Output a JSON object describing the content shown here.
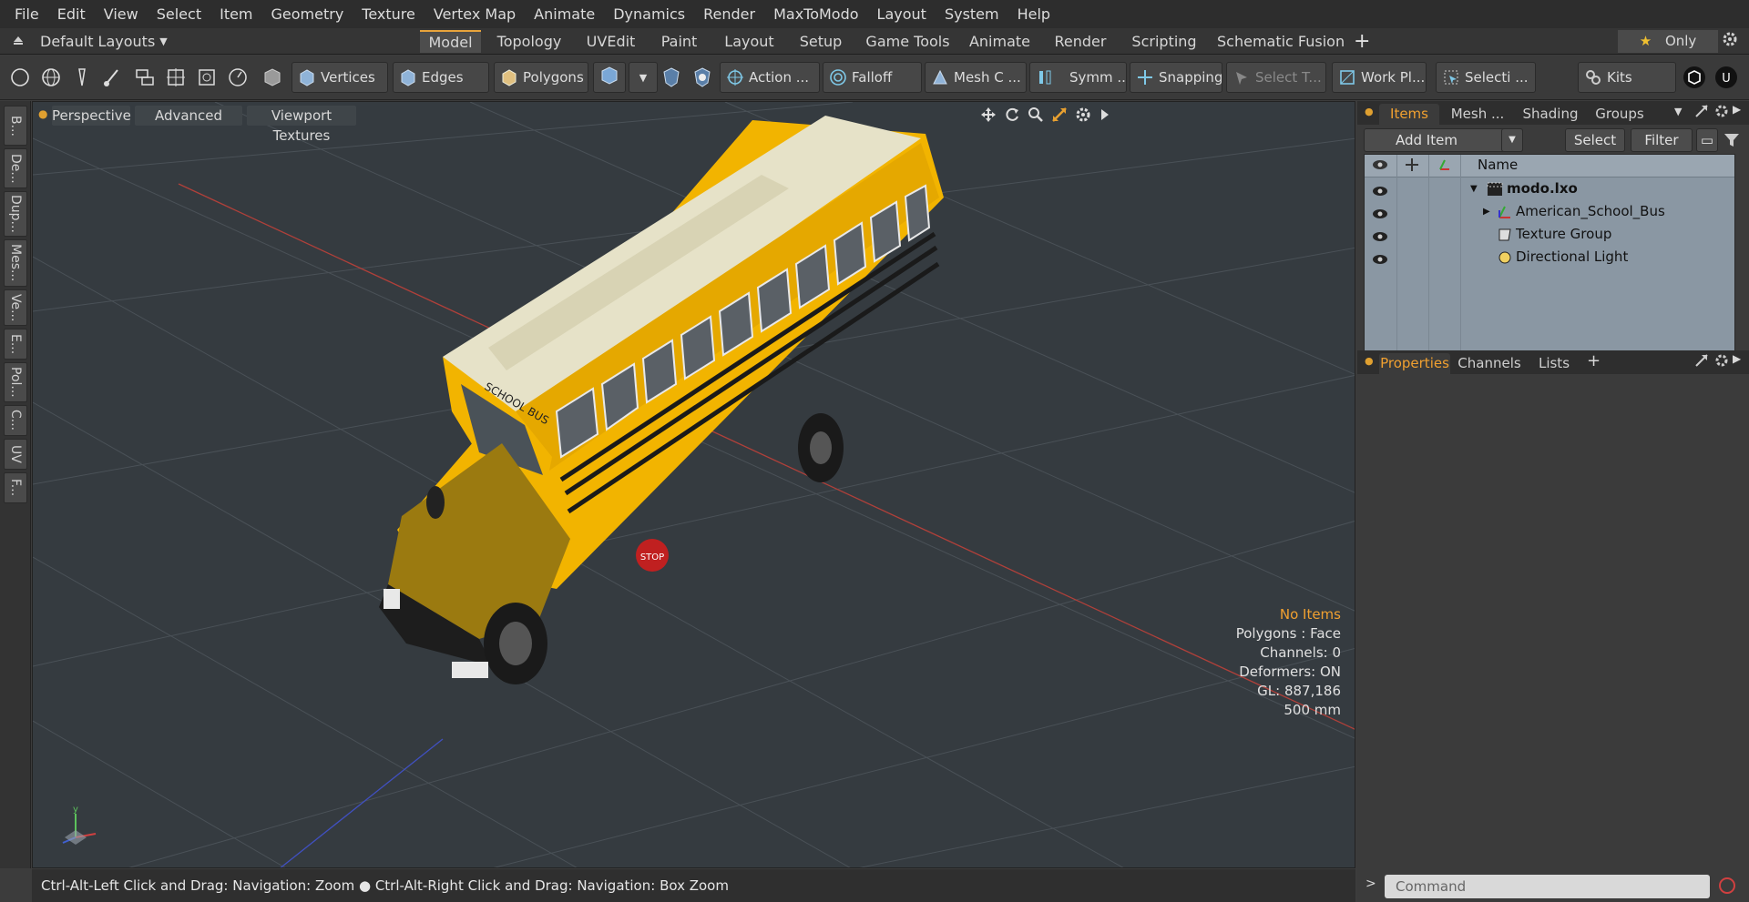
{
  "menu": [
    "File",
    "Edit",
    "View",
    "Select",
    "Item",
    "Geometry",
    "Texture",
    "Vertex Map",
    "Animate",
    "Dynamics",
    "Render",
    "MaxToModo",
    "Layout",
    "System",
    "Help"
  ],
  "layout_selector": "Default Layouts",
  "tabs": [
    "Model",
    "Topology",
    "UVEdit",
    "Paint",
    "Layout",
    "Setup",
    "Game Tools",
    "Animate",
    "Render",
    "Scripting",
    "Schematic Fusion"
  ],
  "active_tab": "Model",
  "only_button": "Only",
  "toolbar": {
    "vertices": "Vertices",
    "edges": "Edges",
    "polygons": "Polygons",
    "action": "Action ...",
    "falloff": "Falloff",
    "mesh": "Mesh C ...",
    "symmetry": "Symm ...",
    "snapping": "Snapping",
    "select_t": "Select T...",
    "workplane": "Work Pl...",
    "selection": "Selecti ...",
    "kits": "Kits"
  },
  "left_tools": [
    "B...",
    "De...",
    "Dup...",
    "Mes...",
    "Ve...",
    "E...",
    "Pol...",
    "C...",
    "UV",
    "F..."
  ],
  "viewport": {
    "tabs": [
      "Perspective",
      "Advanced",
      "Viewport Textures"
    ],
    "stats": [
      "No Items",
      "Polygons : Face",
      "Channels: 0",
      "Deformers: ON",
      "GL: 887,186",
      "500 mm"
    ],
    "bus_sign": "SCHOOL BUS",
    "stop_sign": "STOP"
  },
  "status": "Ctrl-Alt-Left Click and Drag: Navigation: Zoom ● Ctrl-Alt-Right Click and Drag: Navigation: Box Zoom",
  "items_panel": {
    "tabs": [
      "Items",
      "Mesh ...",
      "Shading",
      "Groups"
    ],
    "add_item": "Add Item",
    "select": "Select",
    "filter": "Filter",
    "name_header": "Name",
    "rows": [
      {
        "label": "modo.lxo",
        "bold": true
      },
      {
        "label": "American_School_Bus",
        "bold": false
      },
      {
        "label": "Texture Group",
        "bold": false
      },
      {
        "label": "Directional Light",
        "bold": false
      }
    ]
  },
  "properties_panel": {
    "tabs": [
      "Properties",
      "Channels",
      "Lists"
    ]
  },
  "command_placeholder": "Command",
  "colors": {
    "accent": "#f0a030",
    "viewport_bg": "#353b40",
    "bus_yellow": "#f2b400",
    "roof": "#e6e2c8"
  }
}
